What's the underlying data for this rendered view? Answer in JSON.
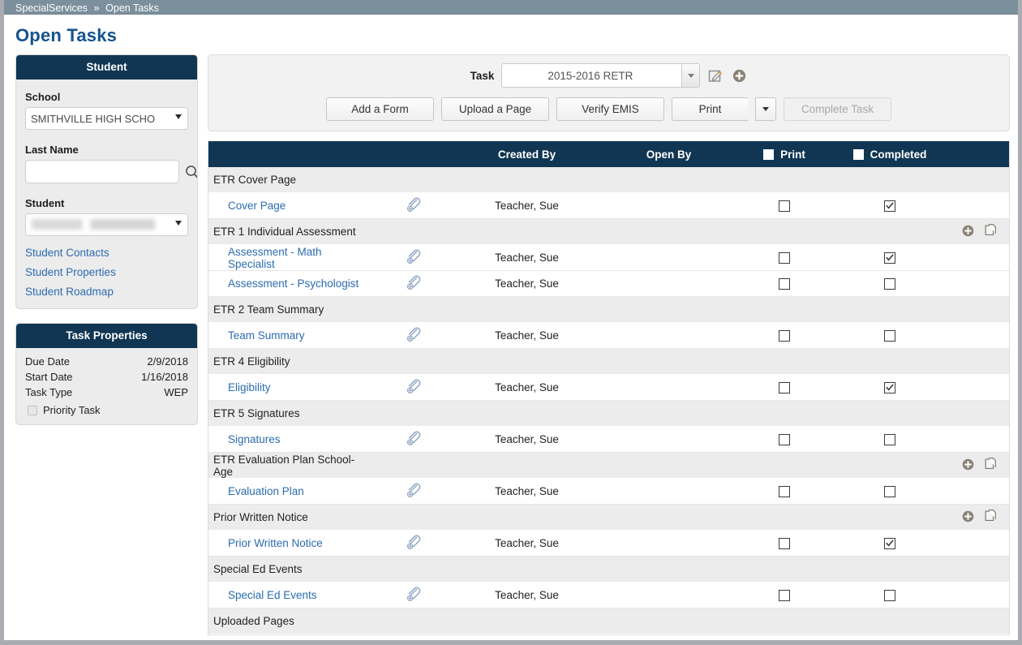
{
  "breadcrumb": {
    "root": "SpecialServices",
    "separator": "»",
    "current": "Open Tasks"
  },
  "page": {
    "title": "Open Tasks"
  },
  "student_panel": {
    "title": "Student",
    "school_label": "School",
    "school_value": "SMITHVILLE HIGH SCHO",
    "last_name_label": "Last Name",
    "last_name_value": "",
    "last_name_placeholder": "",
    "student_label": "Student",
    "student_value": "",
    "links": [
      "Student Contacts",
      "Student Properties",
      "Student Roadmap"
    ]
  },
  "task_properties": {
    "title": "Task Properties",
    "rows": [
      {
        "key": "Due Date",
        "value": "2/9/2018"
      },
      {
        "key": "Start Date",
        "value": "1/16/2018"
      },
      {
        "key": "Task Type",
        "value": "WEP"
      }
    ],
    "priority_label": "Priority Task",
    "priority_checked": false
  },
  "toolbar": {
    "task_label": "Task",
    "task_value": "2015-2016 RETR",
    "edit_icon": "edit-pencil-icon",
    "add_icon": "add-circle-icon",
    "buttons": [
      {
        "label": "Add a Form",
        "disabled": false
      },
      {
        "label": "Upload a Page",
        "disabled": false
      },
      {
        "label": "Verify EMIS",
        "disabled": false
      }
    ],
    "print_label": "Print",
    "complete_label": "Complete Task",
    "complete_disabled": true
  },
  "grid": {
    "columns": {
      "name": "",
      "clip": "",
      "created_by": "Created By",
      "open_by": "Open By",
      "print": "Print",
      "completed": "Completed"
    },
    "rows": [
      {
        "type": "group",
        "name": "ETR Cover Page",
        "actions": false
      },
      {
        "type": "item",
        "name": "Cover Page",
        "created_by": "Teacher, Sue",
        "open_by": "",
        "print": false,
        "completed": true
      },
      {
        "type": "group",
        "name": "ETR 1 Individual Assessment",
        "actions": true
      },
      {
        "type": "item",
        "name": "Assessment - Math Specialist",
        "created_by": "Teacher, Sue",
        "open_by": "",
        "print": false,
        "completed": true
      },
      {
        "type": "item",
        "name": "Assessment - Psychologist",
        "created_by": "Teacher, Sue",
        "open_by": "",
        "print": false,
        "completed": false
      },
      {
        "type": "group",
        "name": "ETR 2 Team Summary",
        "actions": false
      },
      {
        "type": "item",
        "name": "Team Summary",
        "created_by": "Teacher, Sue",
        "open_by": "",
        "print": false,
        "completed": false
      },
      {
        "type": "group",
        "name": "ETR 4 Eligibility",
        "actions": false
      },
      {
        "type": "item",
        "name": "Eligibility",
        "created_by": "Teacher, Sue",
        "open_by": "",
        "print": false,
        "completed": true
      },
      {
        "type": "group",
        "name": "ETR 5 Signatures",
        "actions": false
      },
      {
        "type": "item",
        "name": "Signatures",
        "created_by": "Teacher, Sue",
        "open_by": "",
        "print": false,
        "completed": false
      },
      {
        "type": "group",
        "name": "ETR Evaluation Plan School-Age",
        "actions": true
      },
      {
        "type": "item",
        "name": "Evaluation Plan",
        "created_by": "Teacher, Sue",
        "open_by": "",
        "print": false,
        "completed": false
      },
      {
        "type": "group",
        "name": "Prior Written Notice",
        "actions": true
      },
      {
        "type": "item",
        "name": "Prior Written Notice",
        "created_by": "Teacher, Sue",
        "open_by": "",
        "print": false,
        "completed": true
      },
      {
        "type": "group",
        "name": "Special Ed Events",
        "actions": false
      },
      {
        "type": "item",
        "name": "Special Ed Events",
        "created_by": "Teacher, Sue",
        "open_by": "",
        "print": false,
        "completed": false
      },
      {
        "type": "group",
        "name": "Uploaded Pages",
        "actions": false
      }
    ]
  },
  "colors": {
    "header_navy": "#103653",
    "breadcrumb_gray": "#7b8f9c",
    "link_blue": "#2b6cb0",
    "title_blue": "#14538e",
    "panel_gray": "#ececec"
  }
}
